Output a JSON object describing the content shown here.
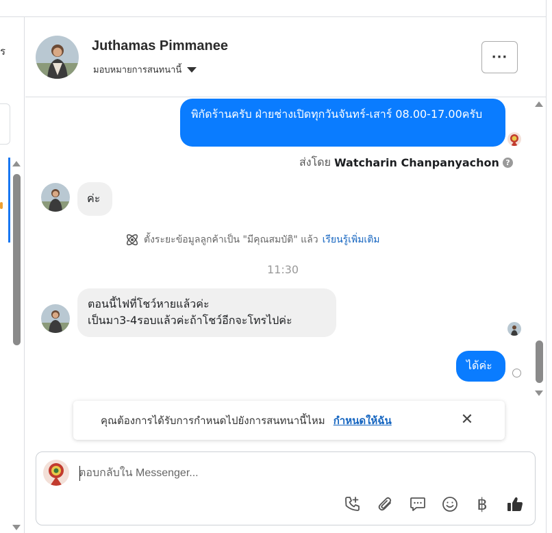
{
  "colors": {
    "accent": "#0a7cff",
    "link": "#1565c0",
    "incoming_bubble": "#f0f0f0"
  },
  "left_panel": {
    "partial_text": "ร"
  },
  "header": {
    "contact_name": "Juthamas Pimmanee",
    "assign_label": "มอบหมายการสนทนานี้",
    "more_label": "···",
    "more_icon": "more-dots-icon"
  },
  "messages": [
    {
      "direction": "outgoing",
      "text": "พิกัดร้านครับ ฝ่ายช่างเปิดทุกวันจันทร์-เสาร์ 08.00-17.00ครับ"
    },
    {
      "direction": "incoming",
      "text": "ค่ะ"
    },
    {
      "direction": "incoming",
      "text": "ตอนนี้ไฟที่โชว์หายแล้วค่ะ\nเป็นมา3-4รอบแล้วค่ะถ้าโชว์อีกจะโทรไปค่ะ"
    },
    {
      "direction": "outgoing",
      "text": "ได้ค่ะ"
    }
  ],
  "sent_by": {
    "prefix": "ส่งโดย",
    "agent": "Watcharin Chanpanyachon",
    "info_icon": "question-icon"
  },
  "system_event": {
    "text": "ตั้งระยะข้อมูลลูกค้าเป็น \"มีคุณสมบัติ\" แล้ว",
    "link": "เรียนรู้เพิ่มเติม",
    "icon": "atom-icon"
  },
  "timestamp": "11:30",
  "assign_banner": {
    "question": "คุณต้องการได้รับการกำหนดไปยังการสนทนานี้ไหม",
    "action": "กำหนดให้ฉัน",
    "close_label": "✕"
  },
  "composer": {
    "placeholder": "ตอบกลับใน Messenger...",
    "tools": [
      "call-add-icon",
      "paperclip-icon",
      "chat-bubble-icon",
      "emoji-icon",
      "baht-icon",
      "thumbs-up-icon"
    ],
    "baht_symbol": "฿"
  }
}
